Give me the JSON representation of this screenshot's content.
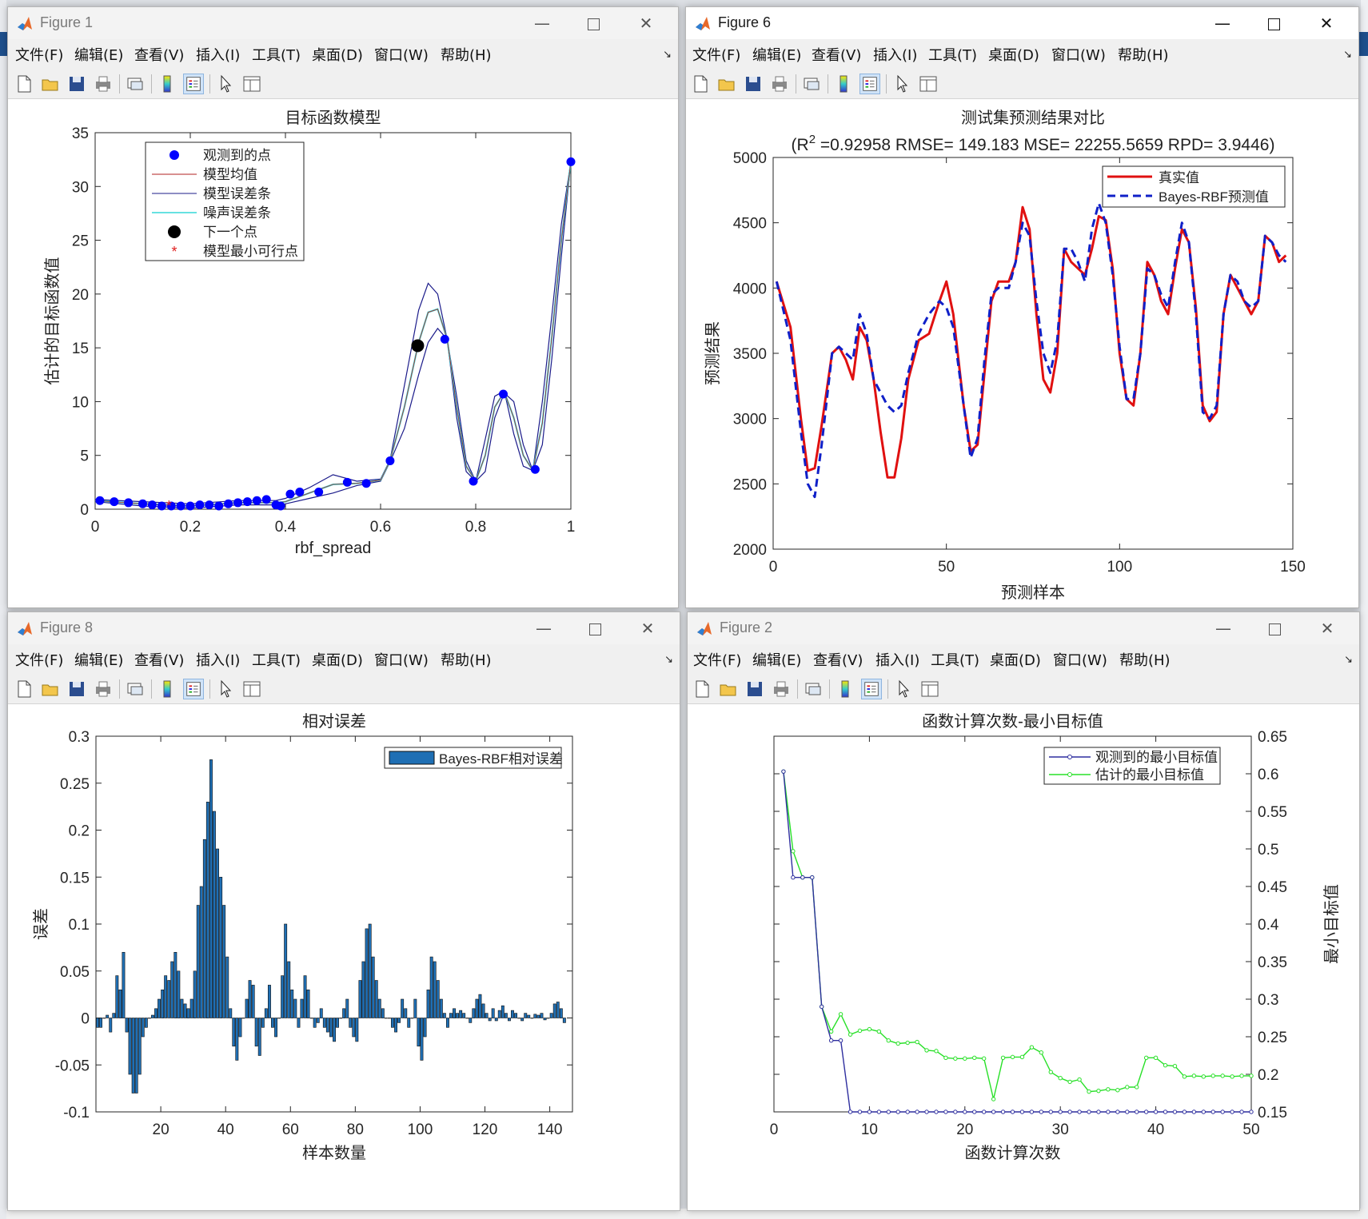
{
  "menu": [
    "文件(F)",
    "编辑(E)",
    "查看(V)",
    "插入(I)",
    "工具(T)",
    "桌面(D)",
    "窗口(W)",
    "帮助(H)"
  ],
  "windows": {
    "fig1": {
      "title": "Figure 1"
    },
    "fig6": {
      "title": "Figure 6"
    },
    "fig8": {
      "title": "Figure 8"
    },
    "fig2": {
      "title": "Figure 2"
    }
  },
  "colors": {
    "observed": "#0000ff",
    "model_mean": "#b22222",
    "model_err": "#1b1b8a",
    "noise_err": "#35d8d8",
    "next_point": "#000000",
    "min_feasible": "#e02020",
    "truth": "#e01010",
    "pred": "#1020c8",
    "bar_fill": "#1f6fb4",
    "obs_min": "#2f2f9f",
    "est_min": "#28e028"
  },
  "chart_data": [
    {
      "id": "fig1",
      "type": "line",
      "title": "目标函数模型",
      "xlabel": "rbf_spread",
      "ylabel": "估计的目标函数值",
      "xlim": [
        0,
        1
      ],
      "ylim": [
        0,
        35
      ],
      "xticks": [
        0,
        0.2,
        0.4,
        0.6,
        0.8,
        1
      ],
      "yticks": [
        0,
        5,
        10,
        15,
        20,
        25,
        30,
        35
      ],
      "legend": [
        "观测到的点",
        "模型均值",
        "模型误差条",
        "噪声误差条",
        "下一个点",
        "模型最小可行点"
      ],
      "legend_position": "top-left",
      "observed_points": {
        "x": [
          0.01,
          0.04,
          0.07,
          0.1,
          0.12,
          0.14,
          0.16,
          0.18,
          0.2,
          0.22,
          0.24,
          0.26,
          0.28,
          0.3,
          0.32,
          0.34,
          0.36,
          0.38,
          0.39,
          0.41,
          0.43,
          0.47,
          0.53,
          0.57,
          0.62,
          0.735,
          0.795,
          0.858,
          0.925,
          1.0
        ],
        "y": [
          0.8,
          0.7,
          0.6,
          0.5,
          0.4,
          0.3,
          0.3,
          0.3,
          0.3,
          0.4,
          0.4,
          0.3,
          0.5,
          0.6,
          0.7,
          0.8,
          0.9,
          0.4,
          0.3,
          1.4,
          1.6,
          1.6,
          2.5,
          2.4,
          4.5,
          15.8,
          2.6,
          10.7,
          3.7,
          32.3
        ]
      },
      "model_mean": {
        "x": [
          0,
          0.1,
          0.2,
          0.3,
          0.38,
          0.4,
          0.45,
          0.5,
          0.55,
          0.6,
          0.62,
          0.65,
          0.68,
          0.7,
          0.72,
          0.74,
          0.76,
          0.78,
          0.8,
          0.82,
          0.84,
          0.86,
          0.88,
          0.9,
          0.92,
          0.94,
          0.96,
          0.98,
          1.0
        ],
        "y": [
          0.8,
          0.5,
          0.3,
          0.6,
          0.6,
          0.7,
          1.5,
          2.3,
          2.4,
          2.7,
          4.5,
          9.5,
          15.5,
          18.3,
          18.6,
          15.8,
          9.5,
          4.0,
          2.6,
          5.0,
          9.5,
          10.9,
          8.5,
          5.0,
          3.6,
          8.0,
          16.0,
          25.0,
          32.3
        ]
      },
      "model_err_upper": {
        "x": [
          0,
          0.1,
          0.2,
          0.3,
          0.38,
          0.4,
          0.45,
          0.5,
          0.55,
          0.6,
          0.62,
          0.65,
          0.68,
          0.7,
          0.72,
          0.74,
          0.76,
          0.78,
          0.8,
          0.82,
          0.84,
          0.86,
          0.88,
          0.9,
          0.92,
          0.94,
          0.96,
          0.98,
          1.0
        ],
        "y": [
          0.9,
          0.7,
          0.5,
          0.8,
          0.8,
          1.0,
          2.0,
          3.2,
          2.6,
          2.8,
          4.6,
          11.5,
          18.5,
          21.0,
          20.0,
          15.8,
          8.5,
          3.5,
          2.6,
          6.5,
          10.5,
          11.0,
          7.0,
          4.0,
          3.6,
          10.0,
          18.0,
          26.5,
          32.3
        ]
      },
      "model_err_lower": {
        "x": [
          0,
          0.1,
          0.2,
          0.3,
          0.38,
          0.4,
          0.45,
          0.5,
          0.55,
          0.6,
          0.62,
          0.65,
          0.68,
          0.7,
          0.72,
          0.74,
          0.76,
          0.78,
          0.8,
          0.82,
          0.84,
          0.86,
          0.88,
          0.9,
          0.92,
          0.94,
          0.96,
          0.98,
          1.0
        ],
        "y": [
          0.7,
          0.3,
          0.1,
          0.4,
          0.4,
          0.5,
          1.0,
          1.5,
          2.2,
          2.6,
          4.4,
          7.5,
          12.5,
          15.5,
          16.8,
          15.8,
          10.5,
          4.5,
          2.6,
          3.5,
          8.5,
          10.8,
          10.0,
          6.0,
          3.6,
          6.0,
          14.0,
          23.5,
          32.3
        ]
      },
      "next_point": {
        "x": 0.678,
        "y": 15.2
      },
      "min_feasible_point": {
        "x": 0.155,
        "y": 0.3
      }
    },
    {
      "id": "fig6",
      "type": "line",
      "title": "测试集预测结果对比",
      "subtitle_prefix": "(R",
      "subtitle_sup": "2",
      "subtitle_rest": " =0.92958 RMSE= 149.183 MSE= 22255.5659 RPD= 3.9446)",
      "xlabel": "预测样本",
      "ylabel": "预测结果",
      "xlim": [
        0,
        150
      ],
      "ylim": [
        2000,
        5000
      ],
      "xticks": [
        0,
        50,
        100,
        150
      ],
      "yticks": [
        2000,
        2500,
        3000,
        3500,
        4000,
        4500,
        5000
      ],
      "legend_position": "top-right",
      "series": [
        {
          "name": "真实值",
          "style": "solid",
          "x": [
            1,
            5,
            8,
            10,
            12,
            14,
            17,
            19,
            21,
            23,
            25,
            27,
            29,
            31,
            33,
            35,
            37,
            39,
            42,
            45,
            48,
            50,
            52,
            55,
            57,
            59,
            61,
            63,
            65,
            68,
            70,
            72,
            74,
            76,
            78,
            80,
            82,
            84,
            86,
            88,
            90,
            92,
            94,
            96,
            98,
            100,
            102,
            104,
            106,
            108,
            110,
            112,
            114,
            116,
            118,
            120,
            122,
            124,
            126,
            128,
            130,
            132,
            134,
            136,
            138,
            140,
            142,
            144,
            146,
            148
          ],
          "y": [
            4050,
            3700,
            3000,
            2600,
            2620,
            2950,
            3500,
            3550,
            3450,
            3300,
            3700,
            3600,
            3300,
            2900,
            2550,
            2550,
            2850,
            3300,
            3600,
            3650,
            3900,
            4050,
            3800,
            3100,
            2750,
            2800,
            3350,
            3900,
            4050,
            4050,
            4200,
            4620,
            4450,
            3800,
            3300,
            3200,
            3500,
            4300,
            4200,
            4150,
            4100,
            4300,
            4550,
            4520,
            4150,
            3500,
            3150,
            3100,
            3500,
            4200,
            4100,
            3900,
            3800,
            4150,
            4450,
            4350,
            3850,
            3100,
            2980,
            3050,
            3800,
            4100,
            4000,
            3900,
            3800,
            3900,
            4400,
            4350,
            4200,
            4250
          ]
        },
        {
          "name": "Bayes-RBF预测值",
          "style": "dashed",
          "x": [
            1,
            5,
            8,
            10,
            12,
            14,
            17,
            19,
            21,
            23,
            25,
            27,
            29,
            31,
            33,
            35,
            37,
            39,
            42,
            45,
            48,
            50,
            52,
            55,
            57,
            59,
            61,
            63,
            65,
            68,
            70,
            72,
            74,
            76,
            78,
            80,
            82,
            84,
            86,
            88,
            90,
            92,
            94,
            96,
            98,
            100,
            102,
            104,
            106,
            108,
            110,
            112,
            114,
            116,
            118,
            120,
            122,
            124,
            126,
            128,
            130,
            132,
            134,
            136,
            138,
            140,
            142,
            144,
            146,
            148
          ],
          "y": [
            4050,
            3600,
            2900,
            2500,
            2400,
            2800,
            3500,
            3550,
            3500,
            3450,
            3800,
            3650,
            3300,
            3200,
            3100,
            3050,
            3100,
            3350,
            3650,
            3800,
            3900,
            3850,
            3700,
            3100,
            2700,
            2850,
            3450,
            3950,
            4000,
            4000,
            4200,
            4500,
            4400,
            3900,
            3500,
            3350,
            3600,
            4300,
            4300,
            4200,
            4050,
            4450,
            4650,
            4500,
            4100,
            3550,
            3150,
            3150,
            3500,
            4150,
            4100,
            3950,
            3850,
            4200,
            4500,
            4350,
            3800,
            3050,
            3000,
            3100,
            3800,
            4100,
            4050,
            3900,
            3850,
            3900,
            4400,
            4350,
            4250,
            4200
          ]
        }
      ]
    },
    {
      "id": "fig8",
      "type": "bar",
      "title": "相对误差",
      "xlabel": "样本数量",
      "ylabel": "误差",
      "xlim": [
        0,
        147
      ],
      "ylim": [
        -0.1,
        0.3
      ],
      "xticks": [
        20,
        40,
        60,
        80,
        100,
        120,
        140
      ],
      "yticks": [
        -0.1,
        -0.05,
        0,
        0.05,
        0.1,
        0.15,
        0.2,
        0.25,
        0.3
      ],
      "legend_position": "top-right",
      "series": [
        {
          "name": "Bayes-RBF相对误差",
          "values": [
            -0.01,
            -0.01,
            0.0,
            0.003,
            -0.015,
            0.005,
            0.045,
            0.03,
            0.07,
            -0.015,
            -0.06,
            -0.08,
            -0.08,
            -0.06,
            -0.02,
            -0.01,
            0.0,
            0.003,
            0.01,
            0.02,
            0.03,
            0.045,
            0.04,
            0.06,
            0.07,
            0.05,
            0.02,
            0.015,
            0.01,
            0.02,
            0.05,
            0.12,
            0.14,
            0.19,
            0.23,
            0.275,
            0.22,
            0.18,
            0.15,
            0.12,
            0.065,
            0.01,
            -0.03,
            -0.045,
            -0.02,
            0.0,
            0.02,
            0.04,
            0.035,
            -0.03,
            -0.04,
            -0.01,
            0.01,
            0.035,
            -0.01,
            -0.02,
            0.0,
            0.045,
            0.1,
            0.06,
            0.03,
            0.02,
            -0.01,
            0.02,
            0.045,
            0.03,
            0.0,
            -0.01,
            -0.005,
            0.01,
            -0.01,
            -0.015,
            -0.02,
            -0.025,
            -0.01,
            0.0,
            0.01,
            0.02,
            -0.01,
            -0.02,
            -0.025,
            0.04,
            0.06,
            0.095,
            0.1,
            0.065,
            0.04,
            0.02,
            0.01,
            0.0,
            0.0,
            -0.01,
            -0.015,
            -0.005,
            0.02,
            0.01,
            -0.01,
            0.0,
            0.02,
            -0.03,
            -0.045,
            -0.02,
            0.03,
            0.065,
            0.06,
            0.04,
            0.02,
            0.005,
            -0.01,
            0.005,
            0.01,
            0.005,
            0.008,
            0.005,
            0.0,
            -0.005,
            0.01,
            0.02,
            0.025,
            0.015,
            0.005,
            -0.003,
            0.01,
            -0.003,
            0.008,
            0.013,
            0.005,
            -0.003,
            0.008,
            0.005,
            0.0,
            -0.003,
            0.005,
            0.003,
            0.0,
            0.004,
            0.003,
            0.005,
            -0.002,
            0.0,
            0.005,
            0.015,
            0.017,
            0.01,
            -0.005
          ]
        }
      ]
    },
    {
      "id": "fig2",
      "type": "line",
      "title": "函数计算次数-最小目标值",
      "xlabel": "函数计算次数",
      "ylabel": "最小目标值",
      "y_axis_side": "right",
      "xlim": [
        0,
        50
      ],
      "ylim": [
        0.15,
        0.65
      ],
      "xticks": [
        0,
        10,
        20,
        30,
        40,
        50
      ],
      "yticks": [
        0.15,
        0.2,
        0.25,
        0.3,
        0.35,
        0.4,
        0.45,
        0.5,
        0.55,
        0.6,
        0.65
      ],
      "legend_position": "top-right",
      "series": [
        {
          "name": "观测到的最小目标值",
          "x": [
            1,
            2,
            3,
            4,
            5,
            6,
            7,
            8,
            9,
            10,
            11,
            12,
            13,
            14,
            15,
            16,
            17,
            18,
            19,
            20,
            21,
            22,
            23,
            24,
            25,
            26,
            27,
            28,
            29,
            30,
            31,
            32,
            33,
            34,
            35,
            36,
            37,
            38,
            39,
            40,
            41,
            42,
            43,
            44,
            45,
            46,
            47,
            48,
            49,
            50
          ],
          "y": [
            0.603,
            0.462,
            0.462,
            0.462,
            0.29,
            0.245,
            0.245,
            0.15,
            0.15,
            0.15,
            0.15,
            0.15,
            0.15,
            0.15,
            0.15,
            0.15,
            0.15,
            0.15,
            0.15,
            0.15,
            0.15,
            0.15,
            0.15,
            0.15,
            0.15,
            0.15,
            0.15,
            0.15,
            0.15,
            0.15,
            0.15,
            0.15,
            0.15,
            0.15,
            0.15,
            0.15,
            0.15,
            0.15,
            0.15,
            0.15,
            0.15,
            0.15,
            0.15,
            0.15,
            0.15,
            0.15,
            0.15,
            0.15,
            0.15,
            0.15
          ]
        },
        {
          "name": "估计的最小目标值",
          "x": [
            1,
            2,
            3,
            4,
            5,
            6,
            7,
            8,
            9,
            10,
            11,
            12,
            13,
            14,
            15,
            16,
            17,
            18,
            19,
            20,
            21,
            22,
            23,
            24,
            25,
            26,
            27,
            28,
            29,
            30,
            31,
            32,
            33,
            34,
            35,
            36,
            37,
            38,
            39,
            40,
            41,
            42,
            43,
            44,
            45,
            46,
            47,
            48,
            49,
            50
          ],
          "y": [
            0.603,
            0.497,
            0.462,
            0.462,
            0.29,
            0.257,
            0.28,
            0.253,
            0.258,
            0.26,
            0.257,
            0.245,
            0.241,
            0.242,
            0.243,
            0.232,
            0.231,
            0.222,
            0.221,
            0.221,
            0.222,
            0.221,
            0.167,
            0.222,
            0.223,
            0.223,
            0.236,
            0.229,
            0.203,
            0.195,
            0.19,
            0.193,
            0.177,
            0.178,
            0.18,
            0.179,
            0.183,
            0.183,
            0.222,
            0.222,
            0.212,
            0.211,
            0.197,
            0.198,
            0.197,
            0.198,
            0.198,
            0.197,
            0.198,
            0.198
          ]
        }
      ]
    }
  ]
}
